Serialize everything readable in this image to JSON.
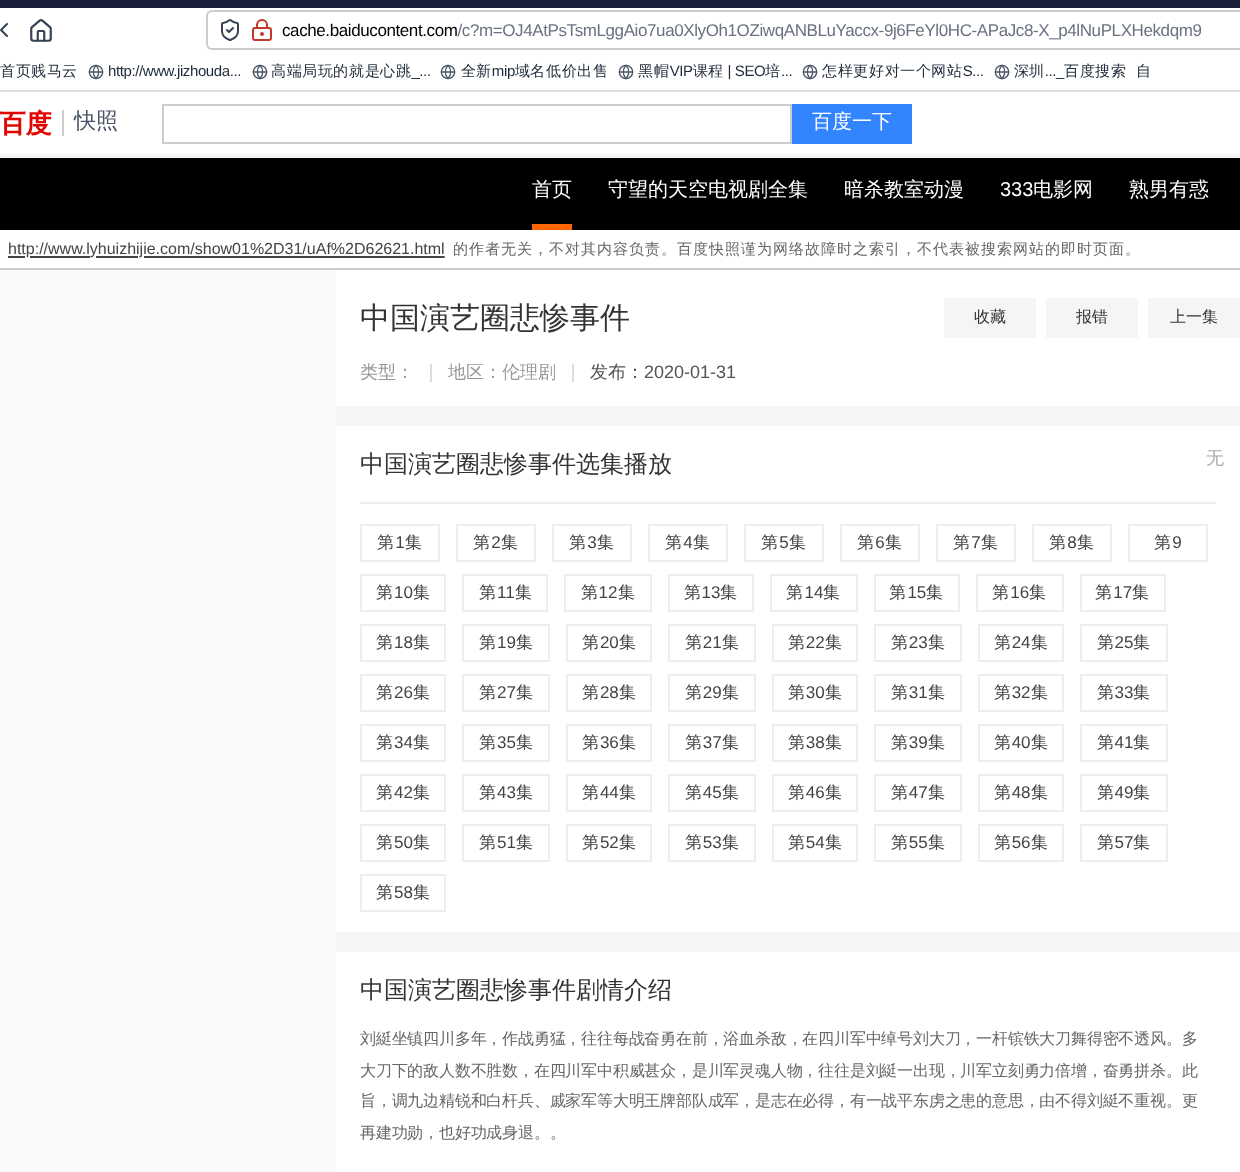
{
  "browser": {
    "url_host": "cache.baiducontent.com",
    "url_path": "/c?m=OJ4AtPsTsmLggAio7ua0XlyOh1OZiwqANBLuYaccx-9j6FeYl0HC-APaJc8-X_p4lNuPLXHekdqm9",
    "bookmarks": [
      {
        "label": "首页贱马云"
      },
      {
        "label": "http://www.jizhouda..."
      },
      {
        "label": "高端局玩的就是心跳_..."
      },
      {
        "label": "全新mip域名低价出售"
      },
      {
        "label": "黑帽VIP课程 | SEO培..."
      },
      {
        "label": "怎样更好对一个网站S..."
      },
      {
        "label": "深圳..._百度搜索"
      },
      {
        "label": "自"
      }
    ]
  },
  "snapshot_header": {
    "logo": "百度",
    "title": "快照",
    "search_button": "百度一下"
  },
  "nav": [
    {
      "label": "首页",
      "selected": true
    },
    {
      "label": "守望的天空电视剧全集",
      "selected": false
    },
    {
      "label": "暗杀教室动漫",
      "selected": false
    },
    {
      "label": "333电影网",
      "selected": false
    },
    {
      "label": "熟男有惑",
      "selected": false
    }
  ],
  "notice": {
    "link": "http://www.lyhuizhijie.com/show01%2D31/uAf%2D62621.html",
    "text": "的作者无关，不对其内容负责。百度快照谨为网络故障时之索引，不代表被搜索网站的即时页面。"
  },
  "info": {
    "title": "中国演艺圈悲惨事件",
    "type_label": "类型：",
    "region": "地区：伦理剧",
    "date": "发布：2020-01-31",
    "buttons": [
      "收藏",
      "报错",
      "上一集"
    ]
  },
  "episodes": {
    "title": "中国演艺圈悲惨事件选集播放",
    "side_text": "无",
    "rows": [
      [
        "第1集",
        "第2集",
        "第3集",
        "第4集",
        "第5集",
        "第6集",
        "第7集",
        "第8集",
        "第9"
      ],
      [
        "第10集",
        "第11集",
        "第12集",
        "第13集",
        "第14集",
        "第15集",
        "第16集",
        "第17集"
      ],
      [
        "第18集",
        "第19集",
        "第20集",
        "第21集",
        "第22集",
        "第23集",
        "第24集",
        "第25集"
      ],
      [
        "第26集",
        "第27集",
        "第28集",
        "第29集",
        "第30集",
        "第31集",
        "第32集",
        "第33集"
      ],
      [
        "第34集",
        "第35集",
        "第36集",
        "第37集",
        "第38集",
        "第39集",
        "第40集",
        "第41集"
      ],
      [
        "第42集",
        "第43集",
        "第44集",
        "第45集",
        "第46集",
        "第47集",
        "第48集",
        "第49集"
      ],
      [
        "第50集",
        "第51集",
        "第52集",
        "第53集",
        "第54集",
        "第55集",
        "第56集",
        "第57集"
      ],
      [
        "第58集"
      ]
    ]
  },
  "intro": {
    "title": "中国演艺圈悲惨事件剧情介绍",
    "lines": [
      "刘綎坐镇四川多年，作战勇猛，往往每战奋勇在前，浴血杀敌，在四川军中绰号刘大刀，一杆镔铁大刀舞得密不透风。多",
      "大刀下的敌人数不胜数，在四川军中积威甚众，是川军灵魂人物，往往是刘綎一出现，川军立刻勇力倍增，奋勇拼杀。此",
      "旨，调九边精锐和白杆兵、戚家军等大明王牌部队成军，是志在必得，有一战平东虏之患的意思，由不得刘綎不重视。更",
      "再建功勋，也好功成身退。。"
    ]
  }
}
